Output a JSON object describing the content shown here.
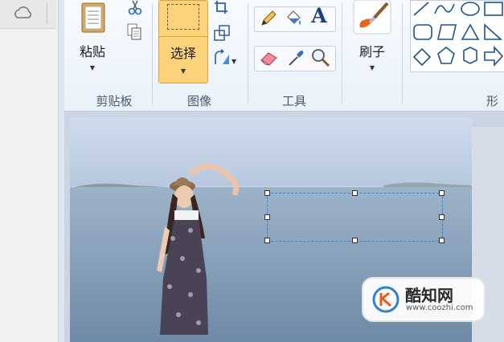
{
  "clipboard": {
    "paste_label": "粘贴",
    "group_label": "剪贴板"
  },
  "image": {
    "select_label": "选择",
    "group_label": "图像"
  },
  "tools": {
    "group_label": "工具",
    "text_glyph": "A"
  },
  "brushes": {
    "label": "刷子"
  },
  "shapes": {
    "group_label_partial": "形"
  },
  "watermark": {
    "brand": "酷知网",
    "url": "www.coozhi.com"
  },
  "colors": {
    "select_active": "#fcd27a",
    "selection_border": "#3b7fd6",
    "sky": "#c7d6ea",
    "sea": "#7f9bb5"
  }
}
